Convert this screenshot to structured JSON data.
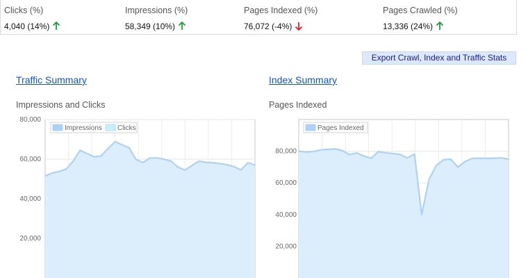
{
  "stats": [
    {
      "label": "Clicks (%)",
      "value": "4,040 (14%)",
      "trend": "up"
    },
    {
      "label": "Impressions (%)",
      "value": "58,349 (10%)",
      "trend": "up"
    },
    {
      "label": "Pages Indexed (%)",
      "value": "76,072 (-4%)",
      "trend": "down"
    },
    {
      "label": "Pages Crawled (%)",
      "value": "13,336 (24%)",
      "trend": "up"
    }
  ],
  "colors": {
    "up": "#1e9e3a",
    "down": "#dd2222",
    "area_fill": "#dcedfc",
    "area_line": "#aed2f3",
    "clicks_swatch": "#c8f0fa"
  },
  "export_button": "Export Crawl, Index and Traffic Stats",
  "traffic": {
    "link": "Traffic Summary",
    "chart_title": "Impressions and Clicks"
  },
  "index": {
    "link": "Index Summary",
    "chart_title": "Pages Indexed"
  },
  "chart_data": [
    {
      "type": "area",
      "title": "Impressions and Clicks",
      "ylim": [
        0,
        80000
      ],
      "yticks": [
        "80,000",
        "60,000",
        "40,000",
        "20,000"
      ],
      "ytick_values": [
        80000,
        60000,
        40000,
        20000
      ],
      "legend_placement": "top-left",
      "grid": true,
      "series": [
        {
          "name": "Impressions",
          "values": [
            51500,
            53000,
            53800,
            55000,
            59000,
            64500,
            62800,
            61200,
            61600,
            65400,
            68800,
            67300,
            65800,
            59800,
            58300,
            60600,
            60600,
            60000,
            59000,
            56000,
            54500,
            56800,
            59000,
            58400,
            58200,
            57800,
            57200,
            56200,
            54600,
            58200,
            57000
          ]
        },
        {
          "name": "Clicks",
          "values": []
        }
      ]
    },
    {
      "type": "area",
      "title": "Pages Indexed",
      "ylim": [
        0,
        100000
      ],
      "yticks": [
        "80,000",
        "60,000",
        "40,000",
        "20,000"
      ],
      "ytick_values": [
        80000,
        60000,
        40000,
        20000
      ],
      "legend_placement": "top-left",
      "grid": true,
      "series": [
        {
          "name": "Pages Indexed",
          "values": [
            80000,
            79500,
            79800,
            80800,
            81200,
            81500,
            80500,
            77800,
            79000,
            77000,
            75500,
            79800,
            79000,
            78600,
            78000,
            75800,
            78200,
            40000,
            62000,
            71000,
            74600,
            75000,
            70000,
            73500,
            75500,
            75600,
            75500,
            75600,
            75800,
            75000
          ]
        }
      ]
    }
  ]
}
